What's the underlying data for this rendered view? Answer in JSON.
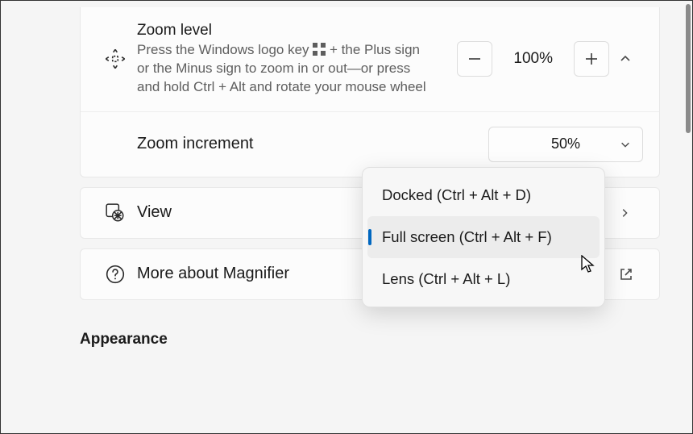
{
  "zoom_card": {
    "title": "Zoom level",
    "desc_pre": "Press the Windows logo key ",
    "desc_post": " + the Plus sign or the Minus sign to zoom in or out—or press and hold Ctrl + Alt and rotate your mouse wheel",
    "minus_label": "−",
    "plus_label": "+",
    "value": "100%",
    "increment_title": "Zoom increment",
    "increment_value": "50%"
  },
  "view_card": {
    "title": "View"
  },
  "more_card": {
    "title": "More about Magnifier"
  },
  "section_heading": "Appearance",
  "menu": {
    "items": [
      {
        "label": "Docked (Ctrl + Alt + D)",
        "selected": false
      },
      {
        "label": "Full screen (Ctrl + Alt + F)",
        "selected": true
      },
      {
        "label": "Lens (Ctrl + Alt + L)",
        "selected": false
      }
    ]
  }
}
